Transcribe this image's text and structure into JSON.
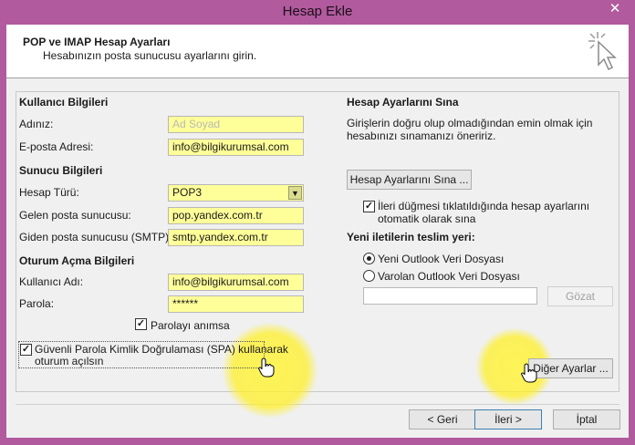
{
  "window": {
    "title": "Hesap Ekle",
    "close_glyph": "✕"
  },
  "header": {
    "title": "POP ve IMAP Hesap Ayarları",
    "subtitle": "Hesabınızın posta sunucusu ayarlarını girin."
  },
  "user_info": {
    "section_label": "Kullanıcı Bilgileri",
    "name_label": "Adınız:",
    "name_placeholder": "Ad Soyad",
    "email_label": "E-posta Adresi:",
    "email_value": "info@bilgikurumsal.com"
  },
  "server_info": {
    "section_label": "Sunucu Bilgileri",
    "account_type_label": "Hesap Türü:",
    "account_type_value": "POP3",
    "incoming_label": "Gelen posta sunucusu:",
    "incoming_value": "pop.yandex.com.tr",
    "outgoing_label": "Giden posta sunucusu (SMTP):",
    "outgoing_value": "smtp.yandex.com.tr"
  },
  "logon_info": {
    "section_label": "Oturum Açma Bilgileri",
    "username_label": "Kullanıcı Adı:",
    "username_value": "info@bilgikurumsal.com",
    "password_label": "Parola:",
    "password_value": "******",
    "remember_label": "Parolayı anımsa",
    "remember_checked": true,
    "spa_label_line1": "Güvenli Parola Kimlik Doğrulaması (SPA) kullanarak",
    "spa_label_line2": "oturum açılsın",
    "spa_checked": true
  },
  "test_settings": {
    "section_label": "Hesap Ayarlarını Sına",
    "description_line1": "Girişlerin doğru olup olmadığından emin olmak için",
    "description_line2": "hesabınızı sınamanızı öneririz.",
    "test_button": "Hesap Ayarlarını Sına ...",
    "auto_test_line1": "İleri düğmesi tıklatıldığında hesap ayarlarını",
    "auto_test_line2": "otomatik olarak sına",
    "auto_test_checked": true
  },
  "delivery": {
    "section_label": "Yeni iletilerin teslim yeri:",
    "option_new": "Yeni Outlook Veri Dosyası",
    "option_existing": "Varolan Outlook Veri Dosyası",
    "selected": "new",
    "browse_button": "Gözat"
  },
  "more_settings_button": "Diğer Ayarlar ...",
  "footer": {
    "back_button": "< Geri",
    "next_button": "İleri >",
    "cancel_button": "İptal"
  },
  "colors": {
    "titlebar": "#b15a9d",
    "field_highlight": "#ffff99",
    "spotlight": "#fff03c"
  },
  "icons": [
    "close-icon",
    "wizard-cursor-icon",
    "hand-cursor-icon",
    "checkmark-icon",
    "dropdown-arrow-icon"
  ]
}
